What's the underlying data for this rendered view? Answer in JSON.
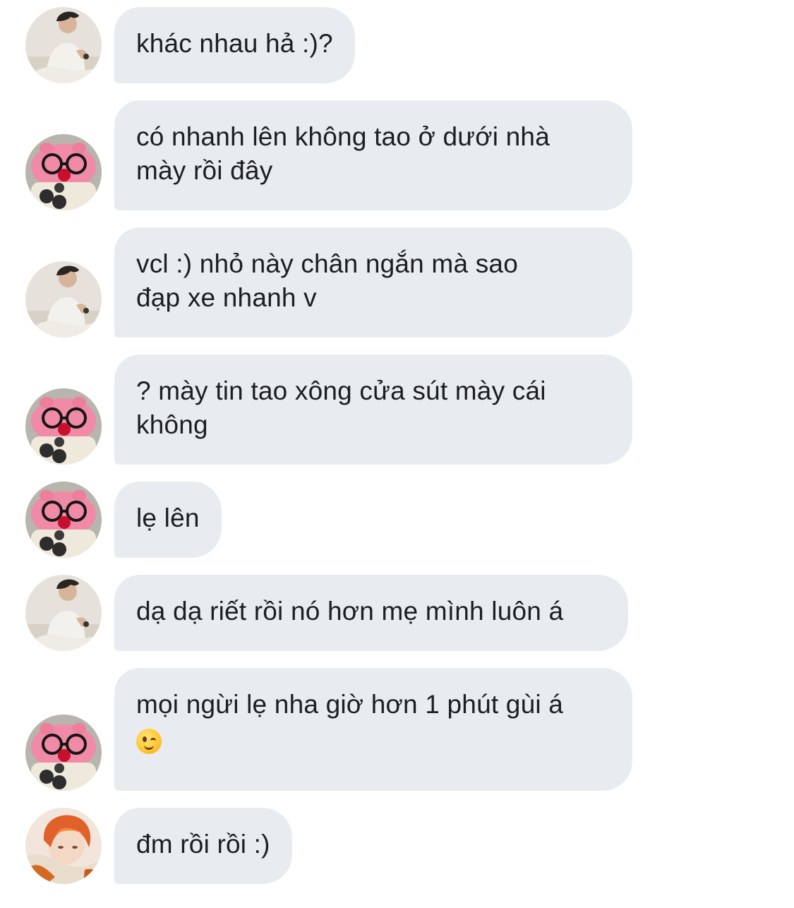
{
  "colors": {
    "bubble_bg": "#e8ecf1",
    "text": "#1c1e21",
    "background": "#ffffff"
  },
  "messages": [
    {
      "sender": "user-boy",
      "avatar_icon": "boy-white-shirt-avatar-icon",
      "lines": [
        "khác nhau hả :)?"
      ]
    },
    {
      "sender": "user-pig",
      "avatar_icon": "pink-pig-glasses-avatar-icon",
      "lines": [
        "có nhanh lên không tao ở dưới nhà",
        "mày rồi đây"
      ]
    },
    {
      "sender": "user-boy",
      "avatar_icon": "boy-white-shirt-avatar-icon",
      "lines": [
        "vcl :) nhỏ này chân ngắn mà sao",
        "đạp xe nhanh v"
      ]
    },
    {
      "sender": "user-pig",
      "avatar_icon": "pink-pig-glasses-avatar-icon",
      "lines": [
        "? mày tin tao xông cửa sút mày cái",
        "không"
      ]
    },
    {
      "sender": "user-pig",
      "avatar_icon": "pink-pig-glasses-avatar-icon",
      "lines": [
        "lẹ lên"
      ]
    },
    {
      "sender": "user-boy",
      "avatar_icon": "boy-white-shirt-avatar-icon",
      "lines": [
        "dạ dạ riết rồi nó hơn mẹ mình luôn á"
      ]
    },
    {
      "sender": "user-pig",
      "avatar_icon": "pink-pig-glasses-avatar-icon",
      "lines": [
        "mọi ngừi lẹ nha giờ hơn 1 phút gùi á"
      ],
      "emoji": "winking-face-emoji"
    },
    {
      "sender": "user-redhair",
      "avatar_icon": "red-hair-boy-avatar-icon",
      "lines": [
        "đm rồi rồi :)"
      ]
    }
  ]
}
